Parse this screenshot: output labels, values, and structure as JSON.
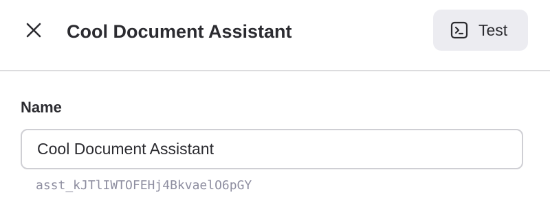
{
  "header": {
    "title": "Cool Document Assistant",
    "close_icon": "close-icon",
    "test_button": {
      "label": "Test",
      "icon": "terminal-icon"
    }
  },
  "form": {
    "name_label": "Name",
    "name_value": "Cool Document Assistant",
    "assistant_id": "asst_kJTlIWTOFEHj4BkvaelO6pGY"
  },
  "colors": {
    "divider": "#dcdcde",
    "test_button_bg": "#ececf1",
    "input_border": "#cfcfd4",
    "id_text": "#8e8ea0",
    "text": "#2b2b30"
  }
}
